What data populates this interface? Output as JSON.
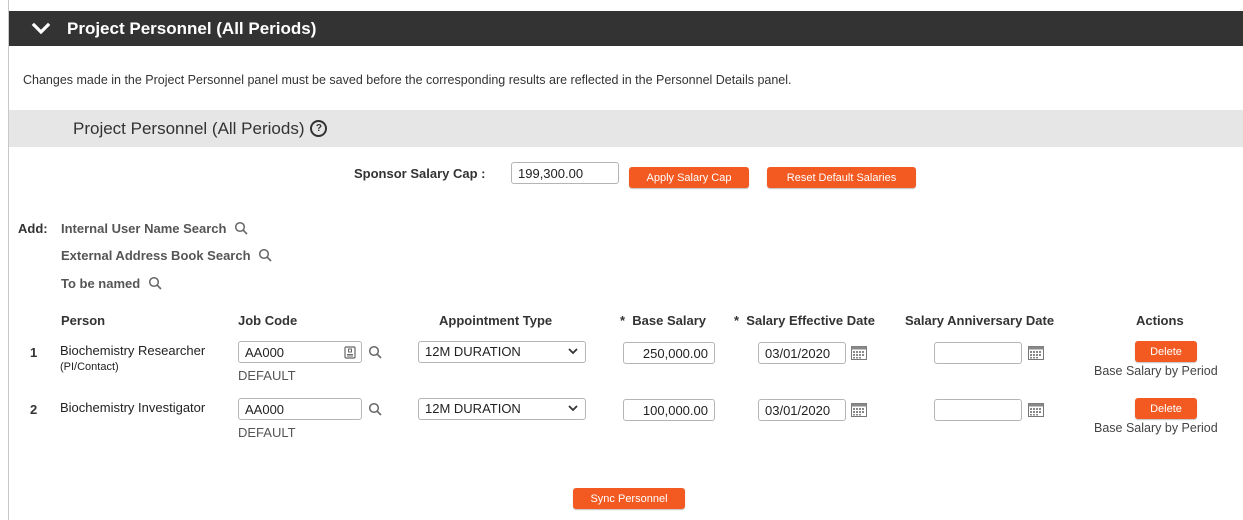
{
  "panel": {
    "title": "Project Personnel (All Periods)",
    "notice": "Changes made in the Project Personnel panel must be saved before the corresponding results are reflected in the Personnel Details panel.",
    "subhead": "Project Personnel (All Periods)"
  },
  "salary_cap": {
    "label": "Sponsor Salary Cap :",
    "value": "199,300.00",
    "apply_label": "Apply Salary Cap",
    "reset_label": "Reset Default Salaries"
  },
  "add": {
    "label": "Add:",
    "options": [
      "Internal User Name Search",
      "External Address Book Search",
      "To be named"
    ]
  },
  "table": {
    "headers": {
      "person": "Person",
      "job_code": "Job Code",
      "appointment_type": "Appointment Type",
      "base_salary": "Base Salary",
      "effective_date": "Salary Effective Date",
      "anniversary_date": "Salary Anniversary Date",
      "actions": "Actions",
      "required_mark": "*"
    },
    "rows": [
      {
        "num": "1",
        "person": "Biochemistry Researcher",
        "role": "(PI/Contact)",
        "job_code": "AA000",
        "job_desc": "DEFAULT",
        "appointment": "12M DURATION",
        "base_salary": "250,000.00",
        "effective_date": "03/01/2020",
        "anniversary_date": "",
        "delete_label": "Delete",
        "period_link": "Base Salary by Period"
      },
      {
        "num": "2",
        "person": "Biochemistry Investigator",
        "role": "",
        "job_code": "AA000",
        "job_desc": "DEFAULT",
        "appointment": "12M DURATION",
        "base_salary": "100,000.00",
        "effective_date": "03/01/2020",
        "anniversary_date": "",
        "delete_label": "Delete",
        "period_link": "Base Salary by Period"
      }
    ]
  },
  "sync_label": "Sync Personnel",
  "colors": {
    "accent": "#f25a22",
    "header_bar": "#333333",
    "subhead_bg": "#e6e6e6"
  },
  "icons": [
    "chevron-down-icon",
    "help-icon",
    "search-icon",
    "calendar-icon",
    "lookup-icon",
    "dropdown-arrow-icon"
  ]
}
